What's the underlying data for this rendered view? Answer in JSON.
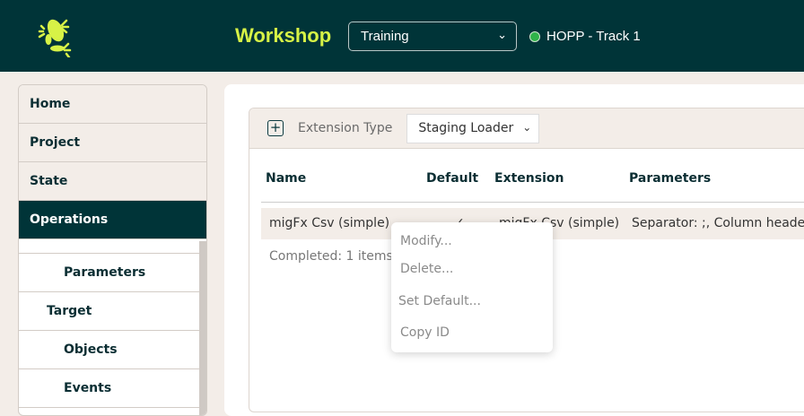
{
  "header": {
    "title": "Workshop",
    "environment": "Training",
    "status_label": "HOPP - Track 1",
    "status_color": "#2fb34a",
    "brand_color": "#d7f246"
  },
  "sidebar": {
    "items": [
      {
        "label": "Home"
      },
      {
        "label": "Project"
      },
      {
        "label": "State"
      },
      {
        "label": "Operations",
        "active": true
      },
      {
        "label": ""
      },
      {
        "label": "Parameters"
      },
      {
        "label": "Target"
      },
      {
        "label": "Objects"
      },
      {
        "label": "Events"
      }
    ]
  },
  "toolbar": {
    "extension_type_label": "Extension Type",
    "extension_type_value": "Staging Loader"
  },
  "table": {
    "columns": [
      "Name",
      "Default",
      "Extension",
      "Parameters"
    ],
    "rows": [
      {
        "name": "migFx Csv (simple)",
        "default": "✓",
        "extension": "migFx Csv (simple)",
        "parameters": "Separator: ;, Column headers:"
      }
    ],
    "status": "Completed: 1 items"
  },
  "context_menu": {
    "items": [
      "Modify...",
      "Delete...",
      "Set Default...",
      "Copy ID"
    ]
  }
}
